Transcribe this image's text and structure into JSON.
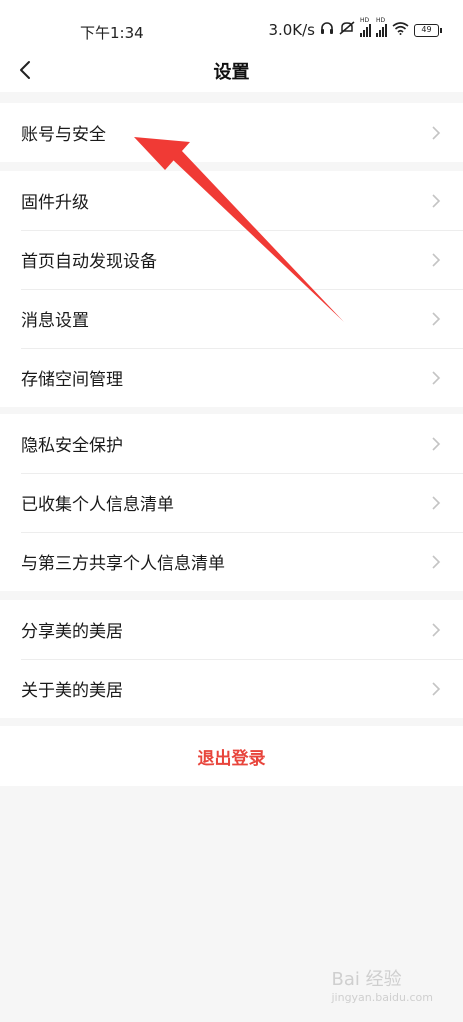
{
  "status_bar": {
    "time": "下午1:34",
    "speed": "3.0K/s",
    "battery": "49"
  },
  "header": {
    "title": "设置"
  },
  "groups": [
    {
      "items": [
        "账号与安全"
      ]
    },
    {
      "items": [
        "固件升级",
        "首页自动发现设备",
        "消息设置",
        "存储空间管理"
      ]
    },
    {
      "items": [
        "隐私安全保护",
        "已收集个人信息清单",
        "与第三方共享个人信息清单"
      ]
    },
    {
      "items": [
        "分享美的美居",
        "关于美的美居"
      ]
    }
  ],
  "logout_label": "退出登录",
  "watermark": {
    "text": "Bai 经验",
    "url": "jingyan.baidu.com"
  },
  "colors": {
    "accent": "#e8453c",
    "background": "#f6f6f6"
  }
}
